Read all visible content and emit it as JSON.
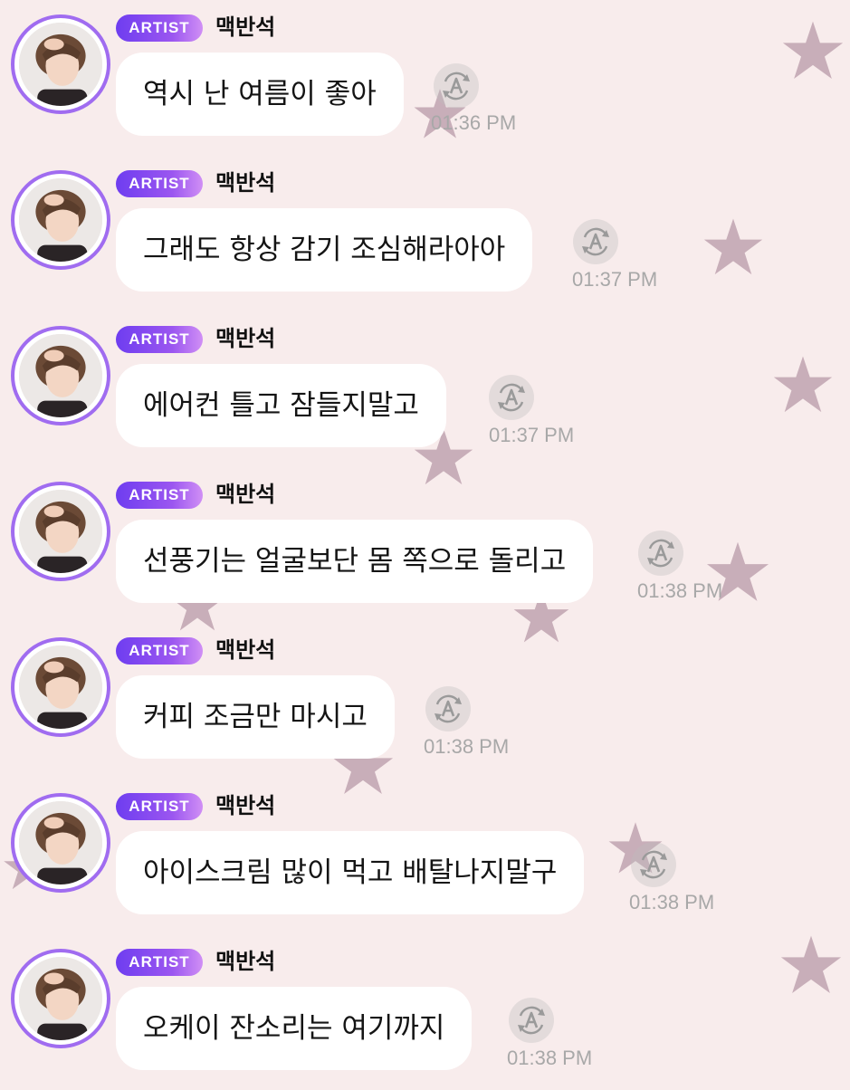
{
  "messages": [
    {
      "badge": "ARTIST",
      "name": "맥반석",
      "text": "역시 난 여름이 좋아",
      "time": "01:36 PM"
    },
    {
      "badge": "ARTIST",
      "name": "맥반석",
      "text": "그래도 항상 감기 조심해라아아",
      "time": "01:37 PM"
    },
    {
      "badge": "ARTIST",
      "name": "맥반석",
      "text": "에어컨 틀고 잠들지말고",
      "time": "01:37 PM"
    },
    {
      "badge": "ARTIST",
      "name": "맥반석",
      "text": "선풍기는 얼굴보단 몸 쪽으로 돌리고",
      "time": "01:38 PM"
    },
    {
      "badge": "ARTIST",
      "name": "맥반석",
      "text": "커피 조금만 마시고",
      "time": "01:38 PM"
    },
    {
      "badge": "ARTIST",
      "name": "맥반석",
      "text": "아이스크림 많이 먹고 배탈나지말구",
      "time": "01:38 PM"
    },
    {
      "badge": "ARTIST",
      "name": "맥반석",
      "text": "오케이 잔소리는 여기까지",
      "time": "01:38 PM"
    }
  ],
  "icons": {
    "avatar": "artist-profile-photo",
    "translate": "translate-icon",
    "background": "star-pattern"
  },
  "colors": {
    "background": "#f8ecec",
    "badge_start": "#6e3df0",
    "badge_end": "#d08ff5",
    "avatar_ring": "#a06cf0",
    "bubble": "#ffffff",
    "timestamp": "#a8a8a8"
  }
}
